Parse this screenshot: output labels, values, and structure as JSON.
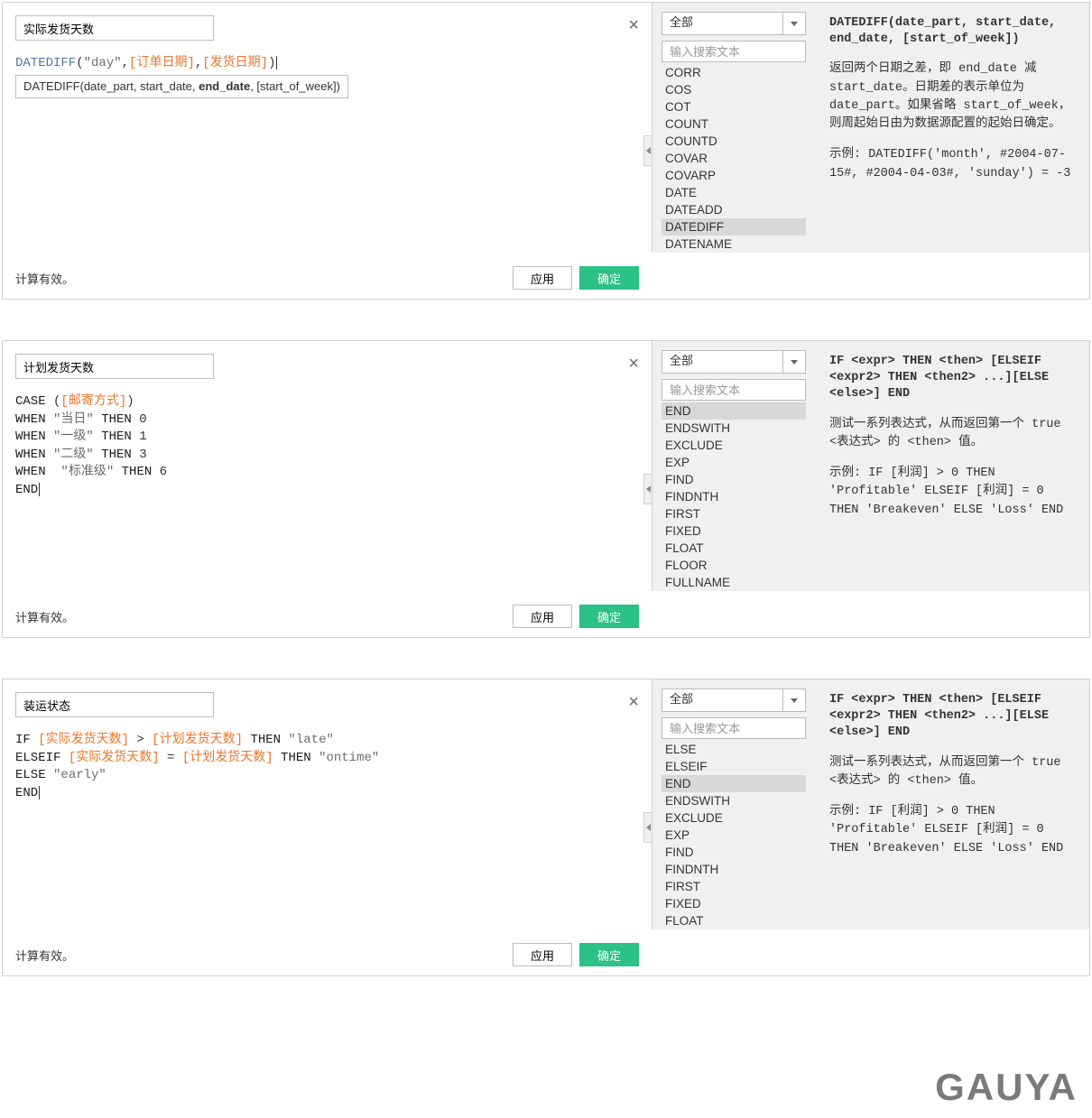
{
  "dialogs": [
    {
      "id": "d1",
      "name": "实际发货天数",
      "formula": {
        "tokens": [
          {
            "cls": "fn",
            "t": "DATEDIFF"
          },
          {
            "cls": "",
            "t": "("
          },
          {
            "cls": "str",
            "t": "\"day\""
          },
          {
            "cls": "",
            "t": ","
          },
          {
            "cls": "fld",
            "t": "[订单日期]"
          },
          {
            "cls": "",
            "t": ","
          },
          {
            "cls": "fld",
            "t": "[发货日期]"
          },
          {
            "cls": "",
            "t": ")"
          }
        ],
        "tooltip": "DATEDIFF(date_part, start_date, end_date, [start_of_week])",
        "tooltip_bold": "end_date"
      },
      "status": "计算有效。",
      "apply": "应用",
      "ok": "确定",
      "category": "全部",
      "search_ph": "输入搜索文本",
      "functions": [
        "CORR",
        "COS",
        "COT",
        "COUNT",
        "COUNTD",
        "COVAR",
        "COVARP",
        "DATE",
        "DATEADD",
        "DATEDIFF",
        "DATENAME"
      ],
      "selected_fn": "DATEDIFF",
      "doc_sig": "DATEDIFF(date_part, start_date, end_date, [start_of_week])",
      "doc_desc": "返回两个日期之差，即 end_date 减 start_date。日期差的表示单位为 date_part。如果省略 start_of_week，则周起始日由为数据源配置的起始日确定。",
      "doc_ex": "示例: DATEDIFF('month', #2004-07-15#, #2004-04-03#, 'sunday') = -3"
    },
    {
      "id": "d2",
      "name": "计划发货天数",
      "formula": {
        "lines": [
          [
            {
              "cls": "kw",
              "t": "CASE "
            },
            {
              "cls": "",
              "t": "("
            },
            {
              "cls": "fld",
              "t": "[邮寄方式]"
            },
            {
              "cls": "",
              "t": ")"
            }
          ],
          [
            {
              "cls": "kw",
              "t": "WHEN "
            },
            {
              "cls": "str",
              "t": "\"当日\""
            },
            {
              "cls": "kw",
              "t": " THEN "
            },
            {
              "cls": "",
              "t": "0"
            }
          ],
          [
            {
              "cls": "kw",
              "t": "WHEN "
            },
            {
              "cls": "str",
              "t": "\"一级\""
            },
            {
              "cls": "kw",
              "t": " THEN "
            },
            {
              "cls": "",
              "t": "1"
            }
          ],
          [
            {
              "cls": "kw",
              "t": "WHEN "
            },
            {
              "cls": "str",
              "t": "\"二级\""
            },
            {
              "cls": "kw",
              "t": " THEN "
            },
            {
              "cls": "",
              "t": "3"
            }
          ],
          [
            {
              "cls": "kw",
              "t": "WHEN  "
            },
            {
              "cls": "str",
              "t": "\"标准级\""
            },
            {
              "cls": "kw",
              "t": " THEN "
            },
            {
              "cls": "",
              "t": "6"
            }
          ],
          [
            {
              "cls": "kw",
              "t": "END"
            }
          ]
        ]
      },
      "status": "计算有效。",
      "apply": "应用",
      "ok": "确定",
      "category": "全部",
      "search_ph": "输入搜索文本",
      "functions": [
        "END",
        "ENDSWITH",
        "EXCLUDE",
        "EXP",
        "FIND",
        "FINDNTH",
        "FIRST",
        "FIXED",
        "FLOAT",
        "FLOOR",
        "FULLNAME"
      ],
      "selected_fn": "END",
      "doc_sig": "IF <expr> THEN <then> [ELSEIF <expr2> THEN <then2> ...][ELSE <else>] END",
      "doc_desc": "测试一系列表达式，从而返回第一个 true <表达式> 的 <then> 值。",
      "doc_ex": "示例: IF [利润] > 0 THEN 'Profitable' ELSEIF [利润] = 0 THEN 'Breakeven' ELSE 'Loss' END"
    },
    {
      "id": "d3",
      "name": "装运状态",
      "formula": {
        "lines": [
          [
            {
              "cls": "kw",
              "t": "IF "
            },
            {
              "cls": "fld",
              "t": "[实际发货天数]"
            },
            {
              "cls": "",
              "t": " > "
            },
            {
              "cls": "fld",
              "t": "[计划发货天数]"
            },
            {
              "cls": "kw",
              "t": " THEN "
            },
            {
              "cls": "str",
              "t": "\"late\""
            }
          ],
          [
            {
              "cls": "kw",
              "t": "ELSEIF "
            },
            {
              "cls": "fld",
              "t": "[实际发货天数]"
            },
            {
              "cls": "",
              "t": " = "
            },
            {
              "cls": "fld",
              "t": "[计划发货天数]"
            },
            {
              "cls": "kw",
              "t": " THEN "
            },
            {
              "cls": "str",
              "t": "\"ontime\""
            }
          ],
          [
            {
              "cls": "kw",
              "t": "ELSE "
            },
            {
              "cls": "str",
              "t": "\"early\""
            }
          ],
          [
            {
              "cls": "kw",
              "t": "END"
            }
          ]
        ]
      },
      "status": "计算有效。",
      "apply": "应用",
      "ok": "确定",
      "category": "全部",
      "search_ph": "输入搜索文本",
      "functions": [
        "ELSE",
        "ELSEIF",
        "END",
        "ENDSWITH",
        "EXCLUDE",
        "EXP",
        "FIND",
        "FINDNTH",
        "FIRST",
        "FIXED",
        "FLOAT"
      ],
      "selected_fn": "END",
      "doc_sig": "IF <expr> THEN <then> [ELSEIF <expr2> THEN <then2> ...][ELSE <else>] END",
      "doc_desc": "测试一系列表达式，从而返回第一个 true <表达式> 的 <then> 值。",
      "doc_ex": "示例: IF [利润] > 0 THEN 'Profitable' ELSEIF [利润] = 0 THEN 'Breakeven' ELSE 'Loss' END"
    }
  ],
  "watermark": "GAUYA"
}
